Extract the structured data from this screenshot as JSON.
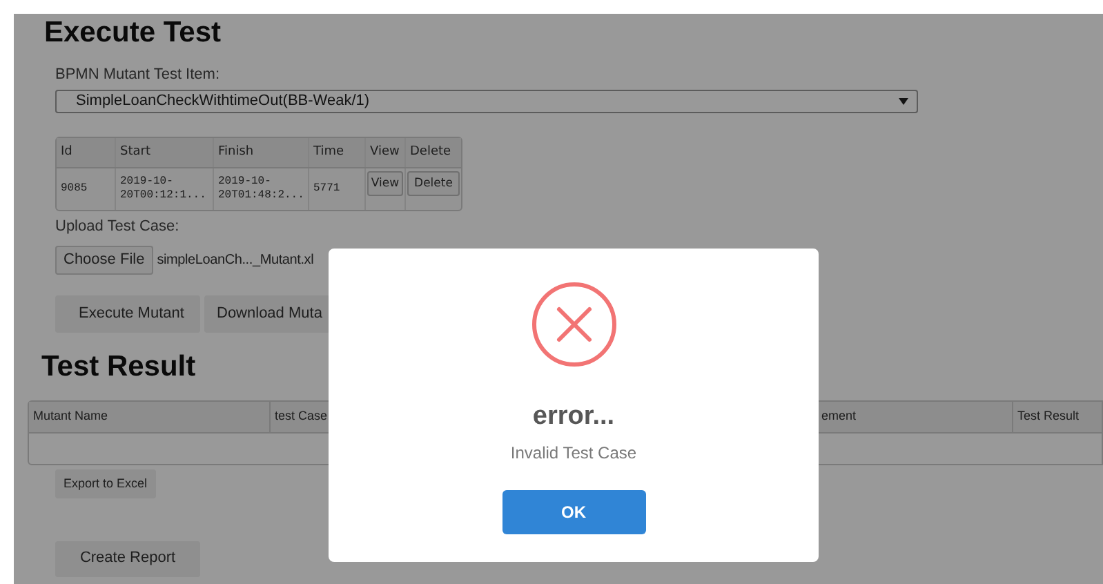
{
  "page_title": "Execute Test",
  "mutant_select": {
    "label": "BPMN Mutant Test Item:",
    "value": "SimpleLoanCheckWithtimeOut(BB-Weak/1)"
  },
  "runs_table": {
    "columns": [
      "Id",
      "Start",
      "Finish",
      "Time",
      "View",
      "Delete"
    ],
    "rows": [
      {
        "id": "9085",
        "start": "2019-10-20T00:12:1...",
        "finish": "2019-10-20T01:48:2...",
        "time": "5771",
        "view_button": "View",
        "delete_button": "Delete"
      }
    ]
  },
  "upload": {
    "label": "Upload Test Case:",
    "button": "Choose File",
    "file_name": "simpleLoanCh..._Mutant.xl"
  },
  "actions": [
    "Execute Mutant",
    "Download Muta"
  ],
  "result_title": "Test Result",
  "result_table": {
    "columns": [
      "Mutant Name",
      "test Case",
      "ement",
      "Test Result"
    ]
  },
  "export_button": "Export to Excel",
  "report_button": "Create Report",
  "dialog": {
    "title": "error...",
    "message": "Invalid Test Case",
    "button": "OK"
  }
}
